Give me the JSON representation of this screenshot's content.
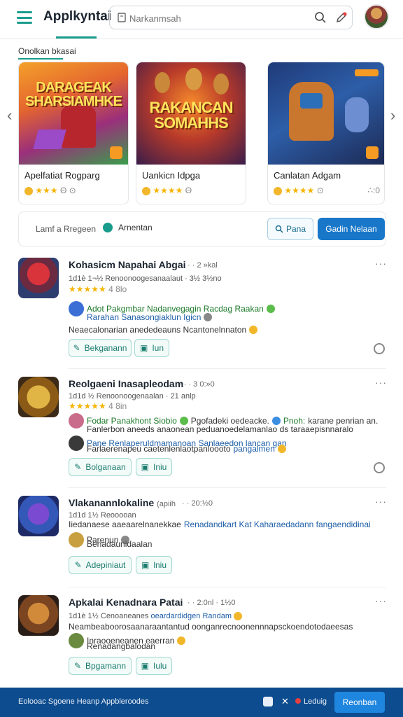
{
  "header": {
    "brand": "Applkyntai",
    "search_placeholder": "Narkanmsah"
  },
  "featured": {
    "section_title": "Onolkan bkasai",
    "cards": [
      {
        "art_text": "DARAGEAK SHARSIAMHKE",
        "title": "Apelfatiat Rogparg",
        "rating_suffix": "Θ"
      },
      {
        "art_text": "RAKANCAN SOMAHHS",
        "title": "Uankicn Idpga",
        "rating_suffix": "Θ"
      },
      {
        "art_text": "",
        "title": "Canlatan Adgam",
        "rating_suffix": "∴:0"
      }
    ]
  },
  "filter": {
    "text": "Lamf a Rregeen",
    "selected": "Arnentan",
    "outline_button": "Pana",
    "primary_button": "Gadin Nelaan"
  },
  "posts": [
    {
      "title": "Kohasicm Napahai Abgai",
      "time": "· · 2 »kal",
      "meta": "1d1è 1¬½  Renoonoogesanaalaut  ·  3½ 3½no",
      "stars": "★★★★★",
      "stars_suffix": "4 8lo",
      "comment_1a": "Adot Pakgmbar Nadanvegagin Racdag Raakan",
      "comment_1b": "Rarahan Sanasongiaklun Igicn",
      "comment_2": "Neaecalonarian anededeauns Ncantonelnnaton",
      "action_1": "Bekganann",
      "action_2": "Iun"
    },
    {
      "title": "Reolgaeni Inasapleodam",
      "time": "· · · 3 0:»0",
      "meta": "1d1d ½  Renoonoogenaalan  ·  21 anlp",
      "stars": "★★★★★",
      "stars_suffix": "4 8in",
      "comment_1a": "Fodar Panakhont Siobio",
      "comment_1b": "Pgofadeki oedeacke.",
      "comment_1c": "Pnoh:",
      "comment_1d": "karane penrian  an.",
      "comment_2": "Fanlerbon aneeds anaonean peduanoedelamanlao ds taraaepisnnaralo",
      "comment_3a": "Pane Renlaperuldmamanoan Sanlaeedon lancan gan",
      "comment_3b": "Farlaerenapeu caetenlenlaotpanloooto",
      "comment_3c": "pangalmen",
      "action_1": "Bolganaan",
      "action_2": "Iniu"
    },
    {
      "title": "Vlakanannlokaline",
      "title_suffix": "(apiih",
      "time": "· ·  20:½0",
      "meta": "1d1d 1½  Reooooan",
      "comment_1a": "Iiedanaese aaeaarelnanekkae",
      "comment_1b": "Renadandkart Kat Kaharaedadann fangaendidinai",
      "comment_2a": "Parenun",
      "comment_2b": "Benadaunidaalan",
      "action_1": "Adepiniaut",
      "action_2": "lniu"
    },
    {
      "title": "Apkalai Kenadnara Patai",
      "time": "· · 2:0nl  · 1½0",
      "meta_a": "1d1è 1½  Cenoaneanes",
      "meta_b": "oeardardidgen Randam",
      "comment_1": "Neambeaboorosaanaraantantud oonganrecnoonennnapsckoendotodaeesas",
      "comment_2a": "Inraooeneanen eaerran",
      "comment_2b": "Renadangbalodan",
      "action_1": "Bpgamann",
      "action_2": "Iulu"
    }
  ],
  "footer": {
    "text": "Eolooac Sgoene Heanp Appbleroodes",
    "label": "Leduig",
    "button": "Reonban"
  }
}
